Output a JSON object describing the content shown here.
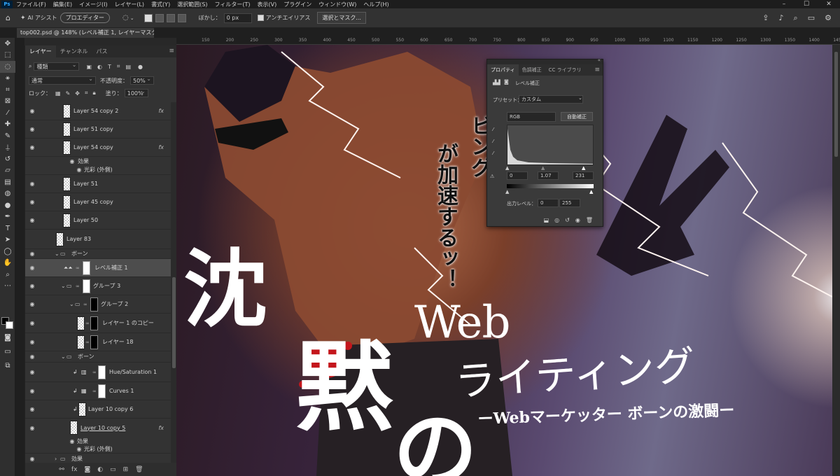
{
  "app": {
    "logo": "Ps"
  },
  "menu": [
    "ファイル(F)",
    "編集(E)",
    "イメージ(I)",
    "レイヤー(L)",
    "書式(Y)",
    "選択範囲(S)",
    "フィルター(T)",
    "表示(V)",
    "プラグイン",
    "ウィンドウ(W)",
    "ヘルプ(H)"
  ],
  "options": {
    "ai_assist": "AI アシスト",
    "pro_editor": "プロエディター",
    "blur_label": "ぼかし：",
    "blur_value": "0 px",
    "antialias": "アンチエイリアス",
    "select_mask": "選択とマスク..."
  },
  "document": {
    "tab_title": "top002.psd @ 148% (レベル補正 1, レイヤーマスク/8) *"
  },
  "rulers": {
    "top": [
      "150",
      "200",
      "250",
      "300",
      "350",
      "400",
      "450",
      "500",
      "550",
      "600",
      "650",
      "700",
      "750",
      "800",
      "850",
      "900",
      "950",
      "1000",
      "1050",
      "1100",
      "1150",
      "1200",
      "1250",
      "1300",
      "1350",
      "1400",
      "1450"
    ]
  },
  "layers_panel": {
    "tabs": [
      "レイヤー",
      "チャンネル",
      "パス"
    ],
    "filter_kind": "種類",
    "blend_mode": "通常",
    "opacity_label": "不透明度：",
    "opacity_value": "50%",
    "lock_label": "ロック：",
    "fill_label": "塗り：",
    "fill_value": "100%"
  },
  "layers": [
    {
      "name": "Layer 54 copy 2",
      "fx": "fx"
    },
    {
      "name": "Layer 51 copy"
    },
    {
      "name": "Layer 54 copy",
      "fx": "fx"
    },
    {
      "name": "効果"
    },
    {
      "name": "光彩 (外側)"
    },
    {
      "name": "Layer 51"
    },
    {
      "name": "Layer 45 copy"
    },
    {
      "name": "Layer 50"
    },
    {
      "name": "Layer 83"
    },
    {
      "name": "ボーン"
    },
    {
      "name": "レベル補正 1"
    },
    {
      "name": "グループ 3"
    },
    {
      "name": "グループ 2"
    },
    {
      "name": "レイヤー 1 のコピー"
    },
    {
      "name": "レイヤー 18"
    },
    {
      "name": "ボーン"
    },
    {
      "name": "Hue/Saturation 1"
    },
    {
      "name": "Curves 1"
    },
    {
      "name": "Layer 10 copy 6"
    },
    {
      "name": "Layer 10 copy 5",
      "fx": "fx"
    },
    {
      "name": "効果"
    },
    {
      "name": "光彩 (外側)"
    },
    {
      "name": "効果"
    }
  ],
  "properties": {
    "tabs": [
      "プロパティ",
      "色調補正",
      "CC ライブラリ"
    ],
    "title": "レベル補正",
    "preset_label": "プリセット：",
    "preset_value": "カスタム",
    "channel": "RGB",
    "auto_button": "自動補正",
    "input_shadow": "0",
    "input_gamma": "1.07",
    "input_highlight": "231",
    "output_label": "出力レベル：",
    "output_low": "0",
    "output_high": "255"
  },
  "artwork": {
    "speech_right": "ビング",
    "speech_left": "が加速するッ！",
    "big_title_1": "沈",
    "big_title_2": "黙",
    "big_title_3": "の",
    "web": "Web",
    "writing": "ライティング",
    "subtitle": "ーWebマーケッター ボーンの激闘ー"
  }
}
